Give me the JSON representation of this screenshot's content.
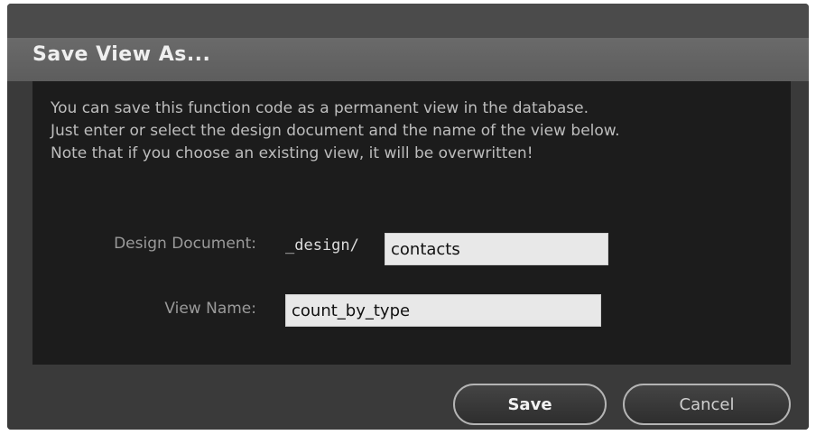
{
  "dialog": {
    "title": "Save View As...",
    "intro_lines": [
      "You can save this function code as a permanent view in the database.",
      "Just enter or select the design document and the name of the view below.",
      "Note that if you choose an existing view, it will be overwritten!"
    ]
  },
  "form": {
    "design_document_label": "Design Document:",
    "design_prefix": "_design/",
    "design_document_value": "contacts",
    "view_name_label": "View Name:",
    "view_name_value": "count_by_type"
  },
  "buttons": {
    "save_label": "Save",
    "cancel_label": "Cancel"
  }
}
